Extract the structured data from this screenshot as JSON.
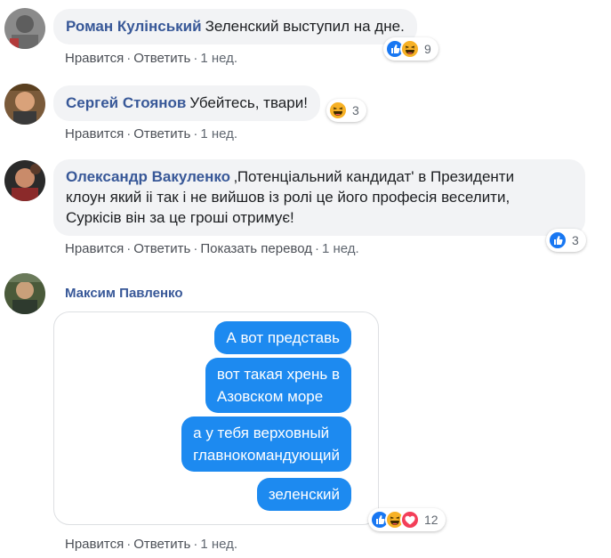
{
  "comments": [
    {
      "author": "Роман Кулінський",
      "text": "Зеленский выступил на дне.",
      "actions": {
        "like": "Нравится",
        "reply": "Ответить",
        "time": "1 нед."
      },
      "reactions": {
        "count": "9",
        "types": [
          "like",
          "haha"
        ]
      }
    },
    {
      "author": "Сергей Стоянов",
      "text": "Убейтесь, твари!",
      "actions": {
        "like": "Нравится",
        "reply": "Ответить",
        "time": "1 нед."
      },
      "reactions": {
        "count": "3",
        "types": [
          "haha"
        ]
      }
    },
    {
      "author": "Олександр Вакуленко",
      "text_line1": "‚Потенціальний кандидат' в Президенти",
      "text_line2": "клоун який іі так і не вийшов із ролі це його професія веселити,",
      "text_line3": "Суркісів він за це гроші отримує!",
      "actions": {
        "like": "Нравится",
        "reply": "Ответить",
        "translate": "Показать перевод",
        "time": "1 нед."
      },
      "reactions": {
        "count": "3",
        "types": [
          "like"
        ]
      }
    },
    {
      "author": "Максим Павленко",
      "image_messages": [
        {
          "line1": "А вот представь"
        },
        {
          "line1": "вот такая хрень в",
          "line2": "Азовском море"
        },
        {
          "line1": "а у тебя верховный",
          "line2": "главнокомандующий"
        },
        {
          "line1": "зеленский"
        }
      ],
      "actions": {
        "like": "Нравится",
        "reply": "Ответить",
        "time": "1 нед."
      },
      "reactions": {
        "count": "12",
        "types": [
          "like",
          "haha",
          "love"
        ]
      }
    }
  ],
  "colors": {
    "author": "#385898",
    "bubble": "#f2f3f5",
    "message_bubble": "#1d8af0",
    "like": "#1877f2",
    "haha": "#f7b125",
    "love": "#f33e58"
  }
}
